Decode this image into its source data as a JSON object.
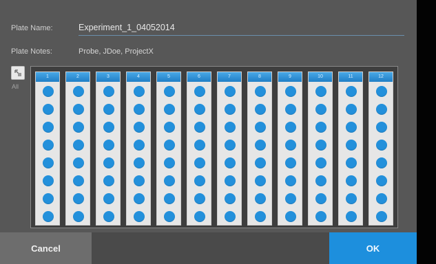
{
  "form": {
    "plate_name_label": "Plate Name:",
    "plate_name_value": "Experiment_1_04052014",
    "plate_notes_label": "Plate Notes:",
    "plate_notes_value": "Probe, JDoe, ProjectX"
  },
  "select_all": {
    "label": "All",
    "icon": "select-all-icon"
  },
  "plate": {
    "columns": [
      "1",
      "2",
      "3",
      "4",
      "5",
      "6",
      "7",
      "8",
      "9",
      "10",
      "11",
      "12"
    ],
    "rows_per_column": 8
  },
  "buttons": {
    "cancel": "Cancel",
    "ok": "OK"
  },
  "colors": {
    "accent": "#1d8fdd",
    "well": "#2390db",
    "panel": "#575757"
  }
}
